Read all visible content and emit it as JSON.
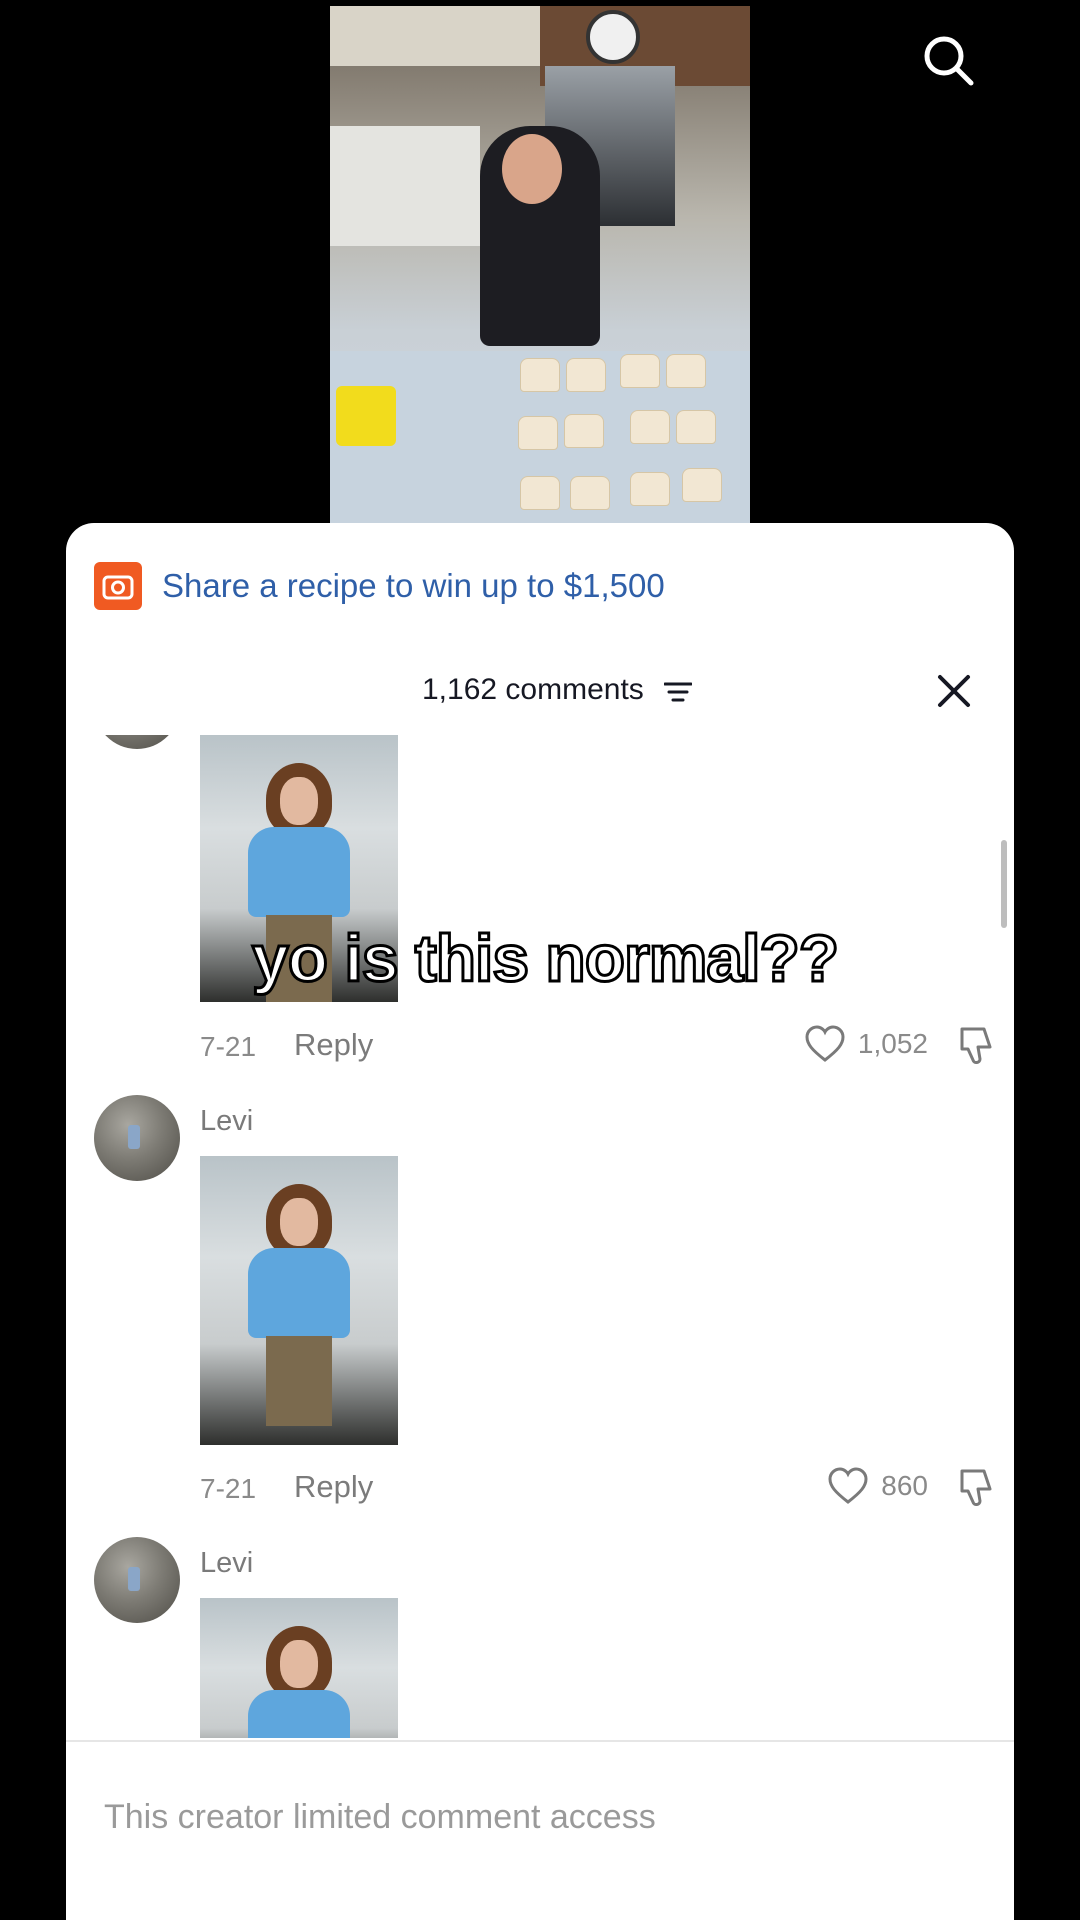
{
  "promo": {
    "text": "Share a recipe to win up to $1,500"
  },
  "header": {
    "comments_count": "1,162 comments"
  },
  "comments": [
    {
      "date": "7-21",
      "reply_label": "Reply",
      "likes": "1,052"
    },
    {
      "username": "Levi",
      "date": "7-21",
      "reply_label": "Reply",
      "likes": "860"
    },
    {
      "username": "Levi"
    }
  ],
  "caption_overlay": "yo is this normal??",
  "footer": {
    "limited_text": "This creator limited comment access"
  },
  "colors": {
    "accent": "#2f5fa8",
    "promo_icon": "#f05a22"
  }
}
